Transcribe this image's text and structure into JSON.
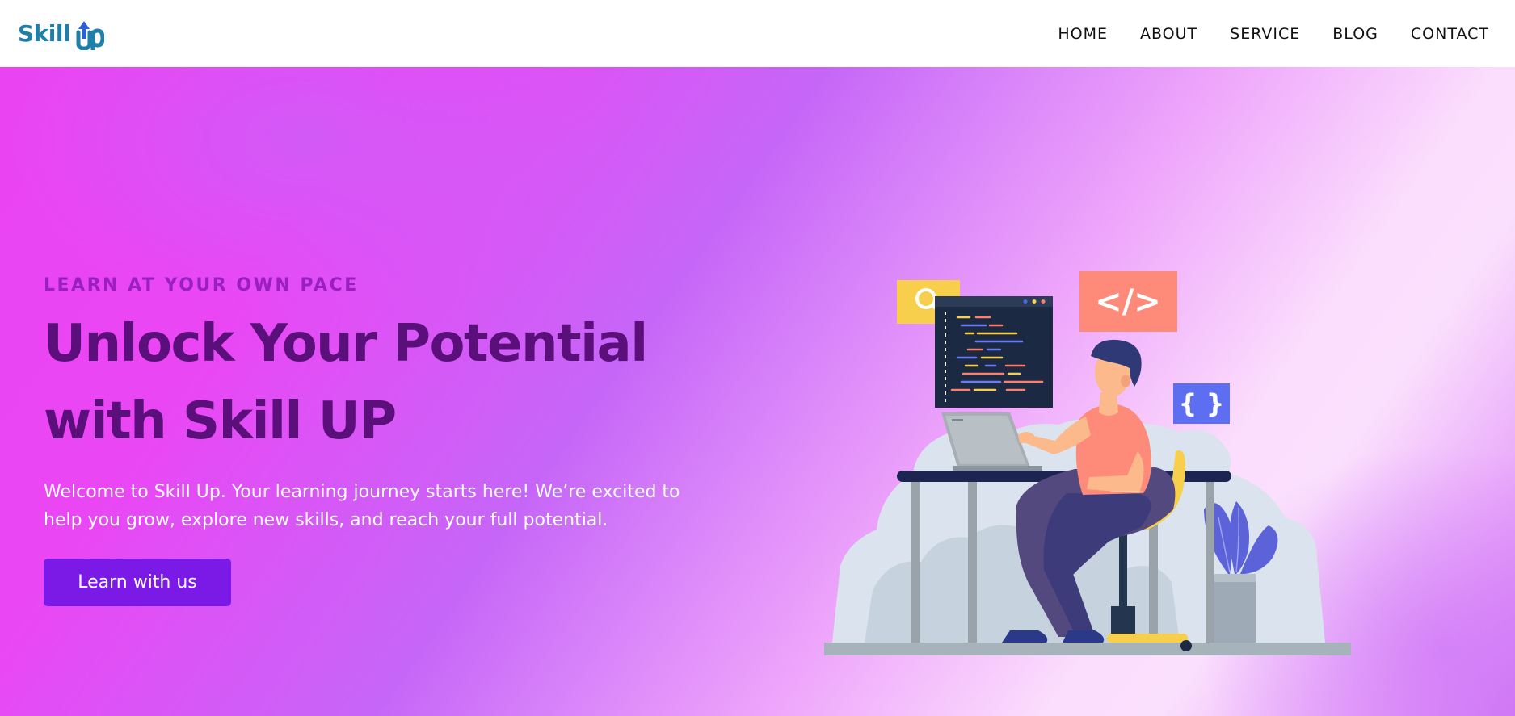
{
  "brand": {
    "name_prefix": "Skill",
    "name_suffix": "p",
    "colors": {
      "teal": "#1e7fa8",
      "arrow": "#2c5fd6"
    },
    "logo_icon": "up-arrow-icon"
  },
  "nav": {
    "items": [
      {
        "label": "HOME"
      },
      {
        "label": "ABOUT"
      },
      {
        "label": "SERVICE"
      },
      {
        "label": "BLOG"
      },
      {
        "label": "CONTACT"
      }
    ]
  },
  "hero": {
    "tagline": "LEARN AT YOUR OWN PACE",
    "headline_line1": "Unlock Your Potential",
    "headline_line2": "with Skill UP",
    "description": "Welcome to Skill Up. Your learning journey starts here! We’re excited to help you grow, explore new skills, and reach your full potential.",
    "cta_label": "Learn with us",
    "colors": {
      "tagline": "#9a1fc2",
      "headline": "#5b0f7a",
      "cta_bg": "#7b1ae6"
    }
  },
  "illustration": {
    "code_tag": "</>",
    "braces": "{ }",
    "icons": [
      "search-icon",
      "code-icon",
      "braces-icon",
      "laptop-icon",
      "plant-icon",
      "chair-icon"
    ]
  }
}
